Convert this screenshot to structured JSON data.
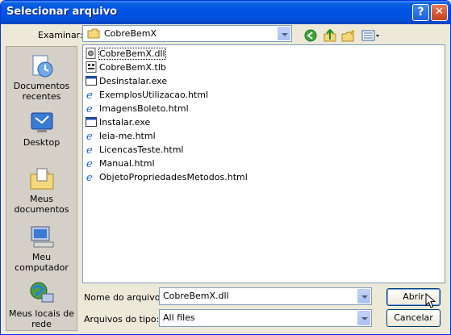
{
  "title": "Selecionar arquivo",
  "lookin": {
    "label": "Examinar:",
    "value": "CobreBemX"
  },
  "files": [
    {
      "name": "CobreBemX.dll",
      "icon": "dll-icon",
      "selected": true
    },
    {
      "name": "CobreBemX.tlb",
      "icon": "tlb-icon"
    },
    {
      "name": "Desinstalar.exe",
      "icon": "exe-icon"
    },
    {
      "name": "ExemplosUtilizacao.html",
      "icon": "ie-html-icon"
    },
    {
      "name": "ImagensBoleto.html",
      "icon": "ie-html-icon"
    },
    {
      "name": "Instalar.exe",
      "icon": "exe-icon"
    },
    {
      "name": "leia-me.html",
      "icon": "ie-html-icon"
    },
    {
      "name": "LicencasTeste.html",
      "icon": "ie-html-icon"
    },
    {
      "name": "Manual.html",
      "icon": "ie-html-icon"
    },
    {
      "name": "ObjetoPropriedadesMetodos.html",
      "icon": "ie-html-icon"
    }
  ],
  "places": [
    {
      "label": "Documentos recentes",
      "icon": "recent-documents-icon"
    },
    {
      "label": "Desktop",
      "icon": "desktop-icon"
    },
    {
      "label": "Meus documentos",
      "icon": "my-documents-icon"
    },
    {
      "label": "Meu computador",
      "icon": "my-computer-icon"
    },
    {
      "label": "Meus locais de rede",
      "icon": "network-places-icon"
    }
  ],
  "filename": {
    "label": "Nome do arquivo:",
    "value": "CobreBemX.dll"
  },
  "filetype": {
    "label": "Arquivos do tipo:",
    "value": "All files"
  },
  "buttons": {
    "open": "Abrir",
    "cancel": "Cancelar"
  },
  "colors": {
    "titlebar": "#0054e3",
    "face": "#ece9d8",
    "border": "#7f9db9"
  }
}
